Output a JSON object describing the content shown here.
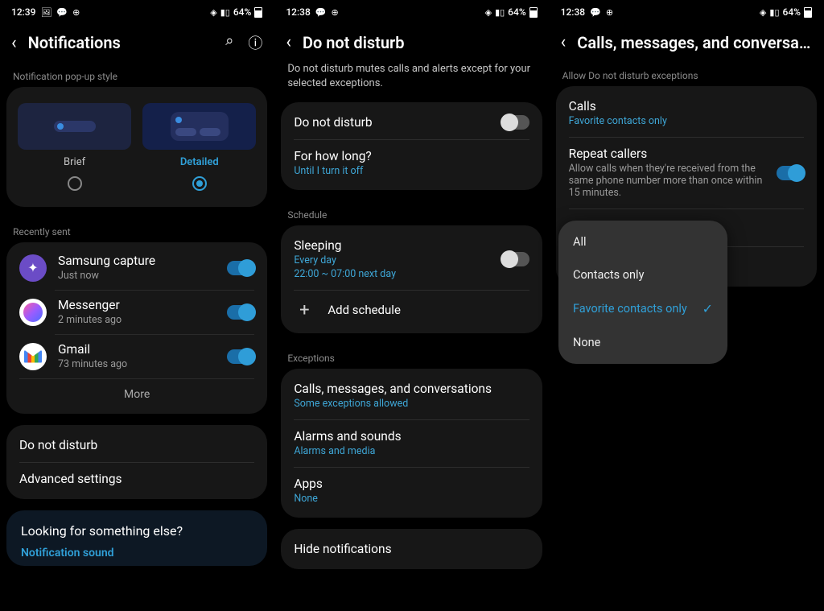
{
  "battery_pct": "64%",
  "screen1": {
    "time": "12:39",
    "title": "Notifications",
    "popup_section_label": "Notification pop-up style",
    "popup_styles": {
      "brief": "Brief",
      "detailed": "Detailed"
    },
    "recently_sent_label": "Recently sent",
    "apps": [
      {
        "name": "Samsung capture",
        "time": "Just now"
      },
      {
        "name": "Messenger",
        "time": "2 minutes ago"
      },
      {
        "name": "Gmail",
        "time": "73 minutes ago"
      }
    ],
    "more": "More",
    "dnd": "Do not disturb",
    "advanced": "Advanced settings",
    "footer_title": "Looking for something else?",
    "footer_link": "Notification sound"
  },
  "screen2": {
    "time": "12:38",
    "title": "Do not disturb",
    "desc": "Do not disturb mutes calls and alerts except for your selected exceptions.",
    "dnd_toggle": "Do not disturb",
    "how_long": "For how long?",
    "how_long_sub": "Until I turn it off",
    "schedule_label": "Schedule",
    "schedule_name": "Sleeping",
    "schedule_days": "Every day",
    "schedule_time": "22:00 ~ 07:00 next day",
    "add_schedule": "Add schedule",
    "exceptions_label": "Exceptions",
    "calls": "Calls, messages, and conversations",
    "calls_sub": "Some exceptions allowed",
    "alarms": "Alarms and sounds",
    "alarms_sub": "Alarms and media",
    "apps": "Apps",
    "apps_sub": "None",
    "hide": "Hide notifications"
  },
  "screen3": {
    "time": "12:38",
    "title": "Calls, messages, and conversa…",
    "section_label": "Allow Do not disturb exceptions",
    "calls": "Calls",
    "calls_sub": "Favorite contacts only",
    "repeat": "Repeat callers",
    "repeat_sub": "Allow calls when they're received from the same phone number more than once within 15 minutes.",
    "dropdown": {
      "all": "All",
      "contacts": "Contacts only",
      "favorites": "Favorite contacts only",
      "none": "None"
    }
  }
}
